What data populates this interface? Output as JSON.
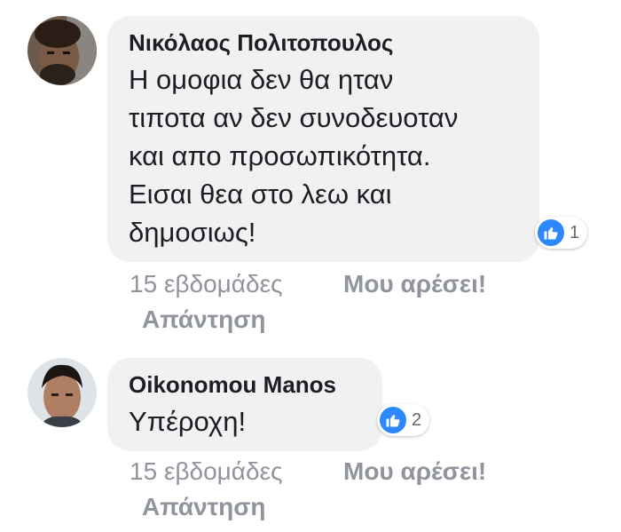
{
  "comments": [
    {
      "author": "Νικόλαος Πολιτοπουλος",
      "text": "Η ομοφια δεν θα ηταν\nτιποτα αν δεν συνοδευοταν\nκαι απο προσωπικότητα.\nΕισαι θεα στο λεω και\nδημοσιως!",
      "reaction_icon": "like-icon",
      "reaction_count": "1",
      "time": "15 εβδομάδες",
      "like_label": "Μου αρέσει!",
      "reply_label": "Απάντηση"
    },
    {
      "author": "Oikonomou Manos",
      "text": "Υπέροχη!",
      "reaction_icon": "like-icon",
      "reaction_count": "2",
      "time": "15 εβδομάδες",
      "like_label": "Μου αρέσει!",
      "reply_label": "Απάντηση"
    }
  ],
  "colors": {
    "bubble": "#f0f1f3",
    "like_badge": "#2d88ff",
    "meta_text": "#90949c"
  }
}
